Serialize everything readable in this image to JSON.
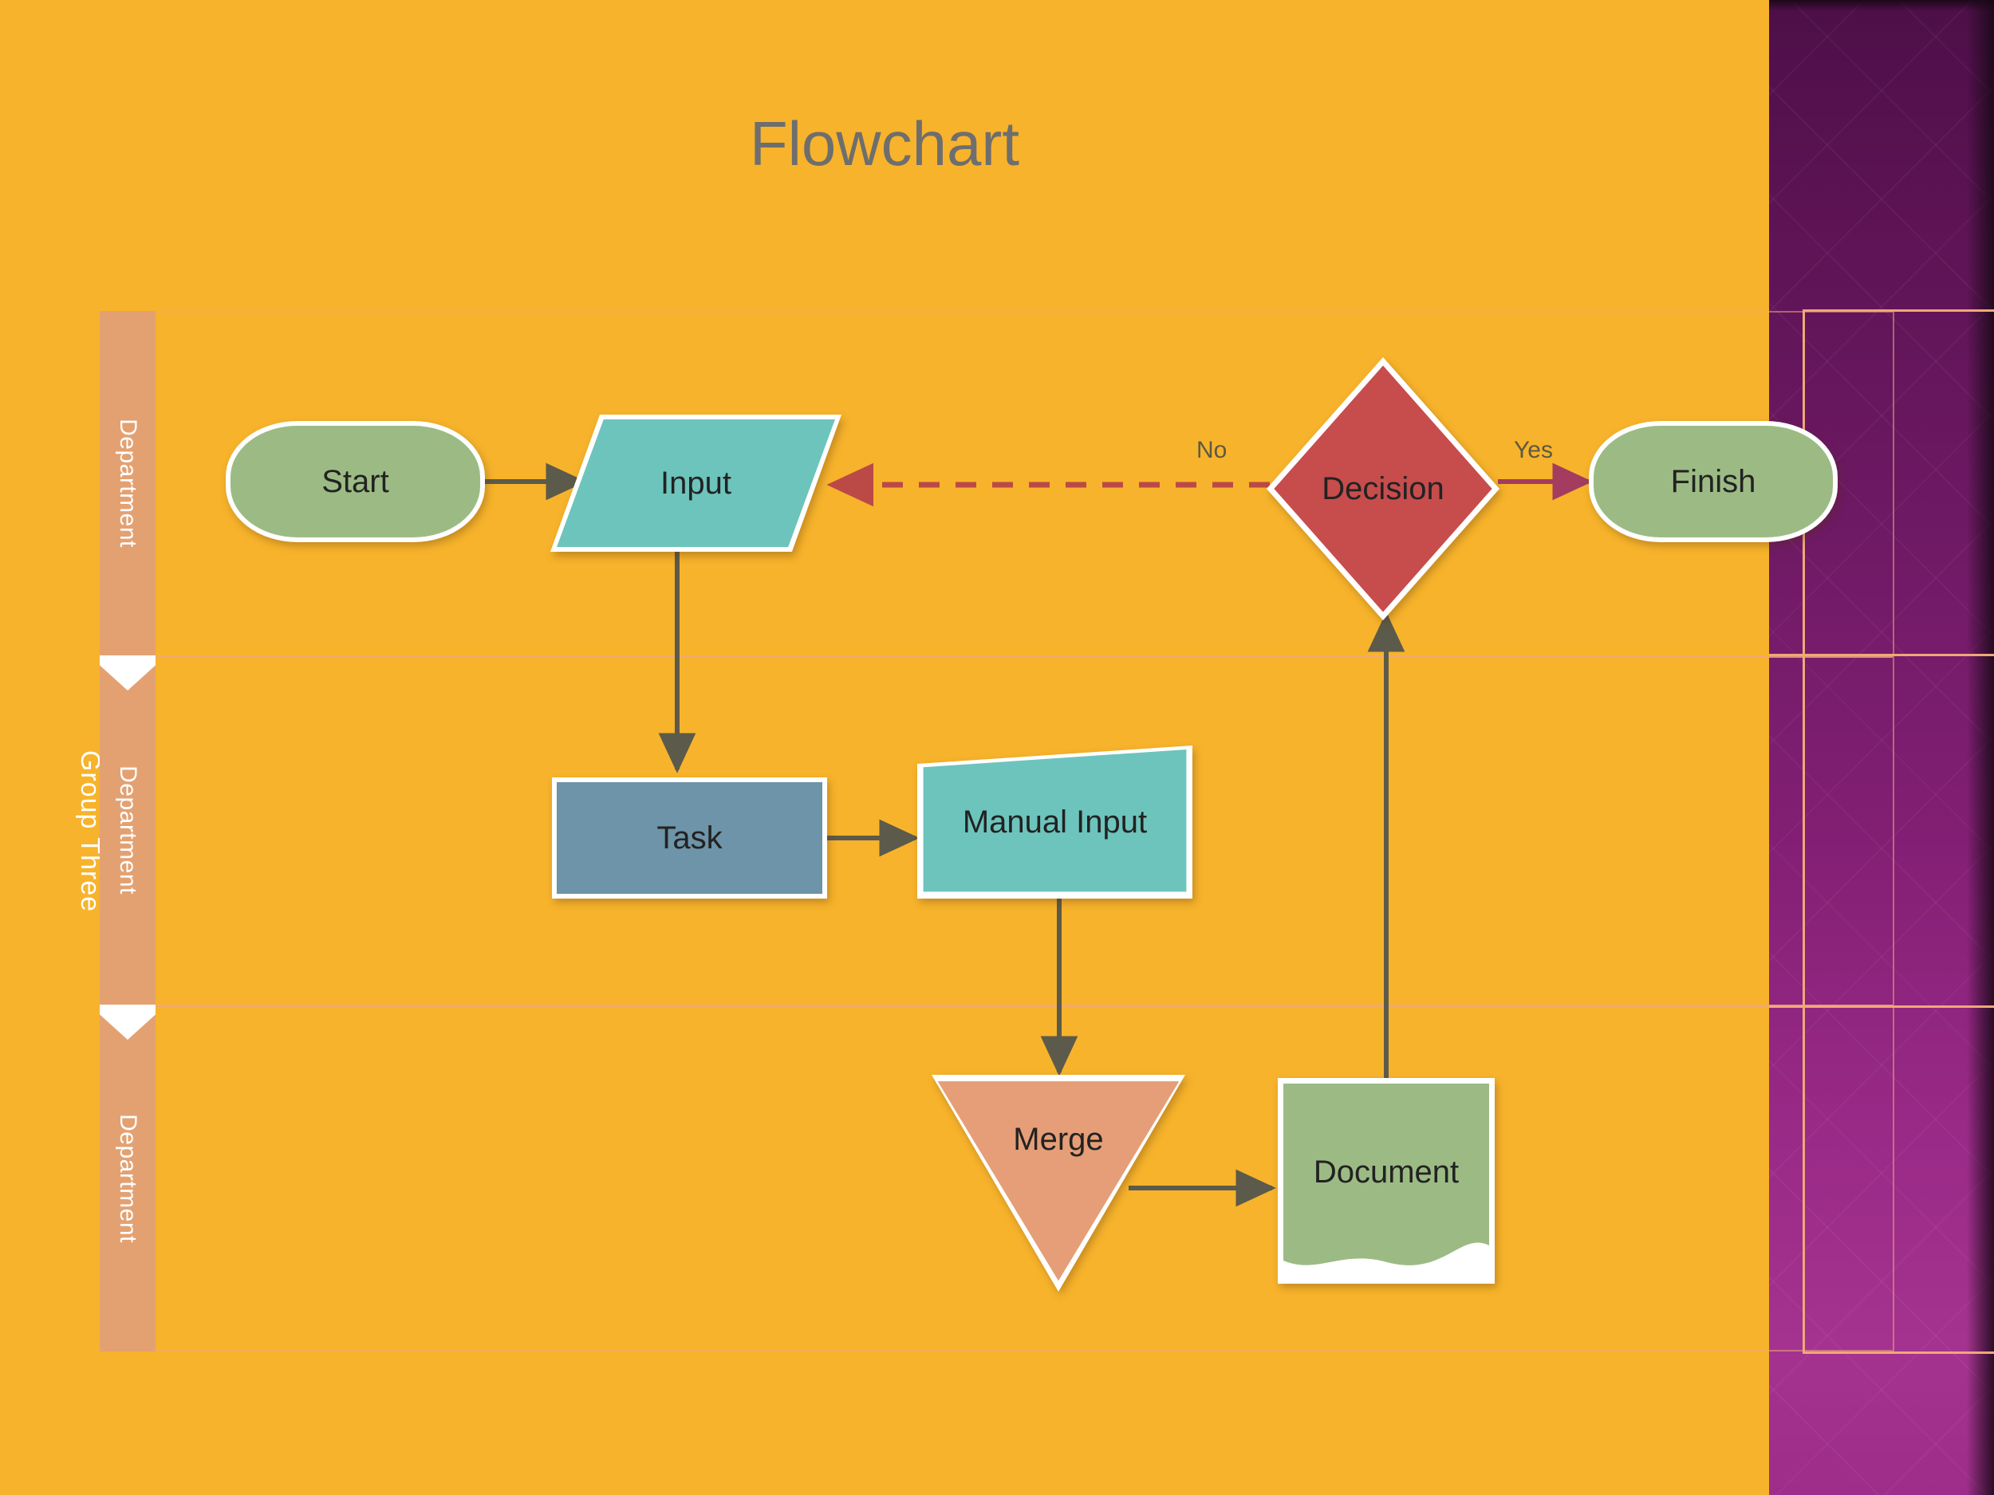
{
  "slide": {
    "title": "Flowchart",
    "background_color": "#F7B32B",
    "accent_color": "#8B2080",
    "title_color": "#6E6E6E"
  },
  "swimlanes": {
    "group_label": "Group Three",
    "lane_column_color": "#E3A172",
    "lanes": [
      {
        "label": "Department"
      },
      {
        "label": "Department"
      },
      {
        "label": "Department"
      }
    ]
  },
  "chart_data": {
    "type": "diagram",
    "title": "Flowchart",
    "nodes": [
      {
        "id": "start",
        "label": "Start",
        "shape": "stadium",
        "lane": 0,
        "fill": "#9CBB84",
        "stroke": "#FFFFFF"
      },
      {
        "id": "input",
        "label": "Input",
        "shape": "parallelogram",
        "lane": 0,
        "fill": "#6DC4BC",
        "stroke": "#FFFFFF"
      },
      {
        "id": "decision",
        "label": "Decision",
        "shape": "diamond",
        "lane": 0,
        "fill": "#C74C4C",
        "stroke": "#FFFFFF"
      },
      {
        "id": "finish",
        "label": "Finish",
        "shape": "stadium",
        "lane": 0,
        "fill": "#9CBB84",
        "stroke": "#FFFFFF"
      },
      {
        "id": "task",
        "label": "Task",
        "shape": "rectangle",
        "lane": 1,
        "fill": "#6D94A8",
        "stroke": "#FFFFFF"
      },
      {
        "id": "manual",
        "label": "Manual Input",
        "shape": "manual-input",
        "lane": 1,
        "fill": "#6DC4BC",
        "stroke": "#FFFFFF"
      },
      {
        "id": "merge",
        "label": "Merge",
        "shape": "triangle-down",
        "lane": 2,
        "fill": "#E59E77",
        "stroke": "#FFFFFF"
      },
      {
        "id": "document",
        "label": "Document",
        "shape": "document",
        "lane": 2,
        "fill": "#9CBB84",
        "stroke": "#FFFFFF"
      }
    ],
    "edges": [
      {
        "from": "start",
        "to": "input",
        "label": "",
        "style": "solid",
        "color": "#5C5A4A"
      },
      {
        "from": "input",
        "to": "task",
        "label": "",
        "style": "solid",
        "color": "#5C5A4A"
      },
      {
        "from": "task",
        "to": "manual",
        "label": "",
        "style": "solid",
        "color": "#5C5A4A"
      },
      {
        "from": "manual",
        "to": "merge",
        "label": "",
        "style": "solid",
        "color": "#5C5A4A"
      },
      {
        "from": "merge",
        "to": "document",
        "label": "",
        "style": "solid",
        "color": "#5C5A4A"
      },
      {
        "from": "document",
        "to": "decision",
        "label": "",
        "style": "solid",
        "color": "#5C5A4A"
      },
      {
        "from": "decision",
        "to": "finish",
        "label": "Yes",
        "style": "solid",
        "color": "#A33C5E"
      },
      {
        "from": "decision",
        "to": "input",
        "label": "No",
        "style": "dashed",
        "color": "#C0492E"
      }
    ]
  },
  "nodes": {
    "start": "Start",
    "input": "Input",
    "decision": "Decision",
    "finish": "Finish",
    "task": "Task",
    "manual_input": "Manual Input",
    "merge": "Merge",
    "document": "Document"
  },
  "edge_labels": {
    "yes": "Yes",
    "no": "No"
  }
}
